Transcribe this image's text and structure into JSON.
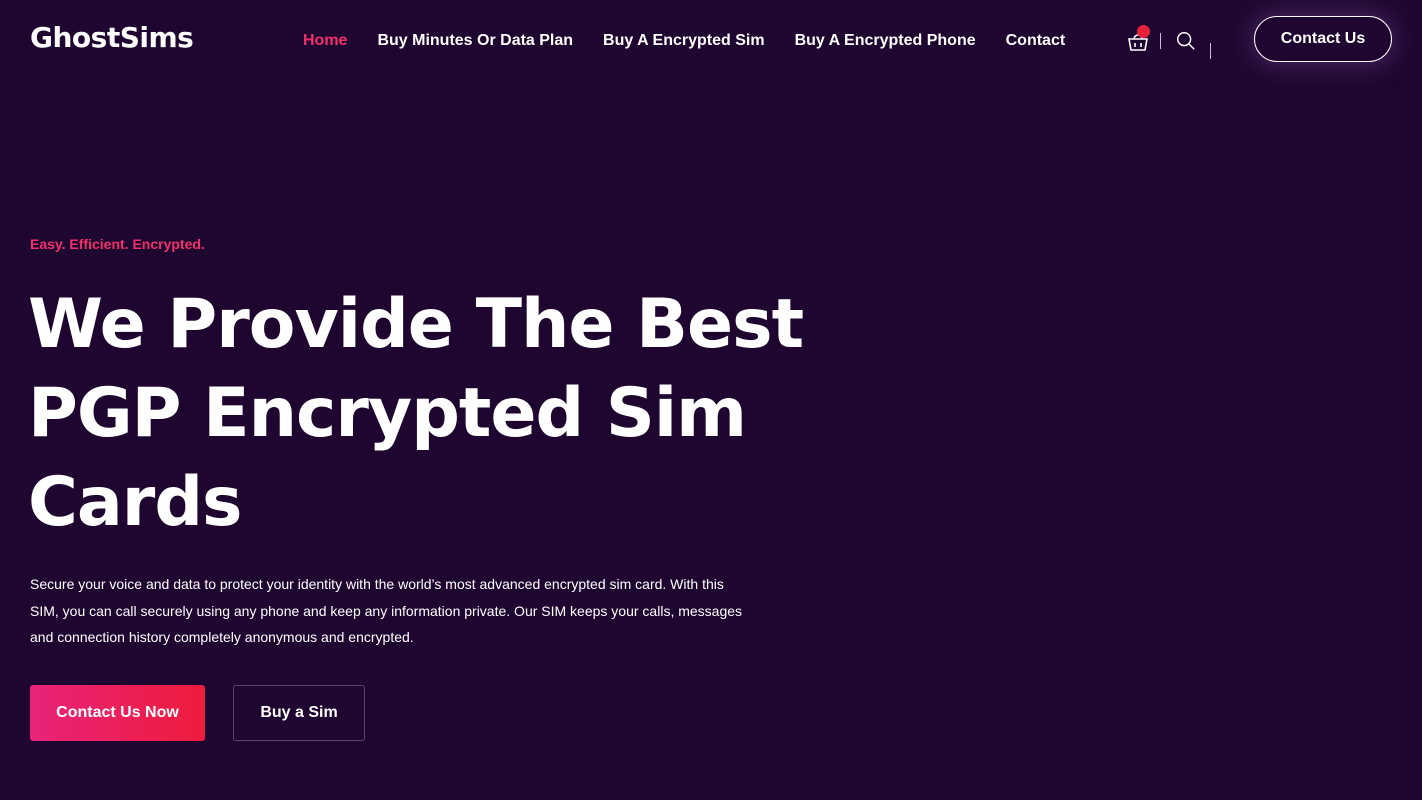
{
  "header": {
    "logo": "GhostSims",
    "nav": [
      {
        "label": "Home",
        "active": true
      },
      {
        "label": "Buy Minutes Or Data Plan",
        "active": false
      },
      {
        "label": "Buy A Encrypted Sim",
        "active": false
      },
      {
        "label": "Buy A Encrypted Phone",
        "active": false
      },
      {
        "label": "Contact",
        "active": false
      }
    ],
    "icons": {
      "cart": "cart-icon",
      "search": "search-icon"
    },
    "contact_button": "Contact Us"
  },
  "hero": {
    "tagline": "Easy. Efficient. Encrypted.",
    "headline": "We Provide The Best PGP Encrypted Sim Cards",
    "description": "Secure your voice and data to protect your identity with the world’s most advanced encrypted sim card. With this SIM, you can call securely using any phone and keep any information private.  Our SIM keeps your calls, messages and connection history completely anonymous and encrypted.",
    "primary_button": "Contact Us Now",
    "secondary_button": "Buy a Sim"
  },
  "colors": {
    "background": "#1f0630",
    "accent": "#f0306a",
    "button_gradient_start": "#e8237a",
    "button_gradient_end": "#ee1c3c",
    "cart_badge": "#e8213a"
  }
}
